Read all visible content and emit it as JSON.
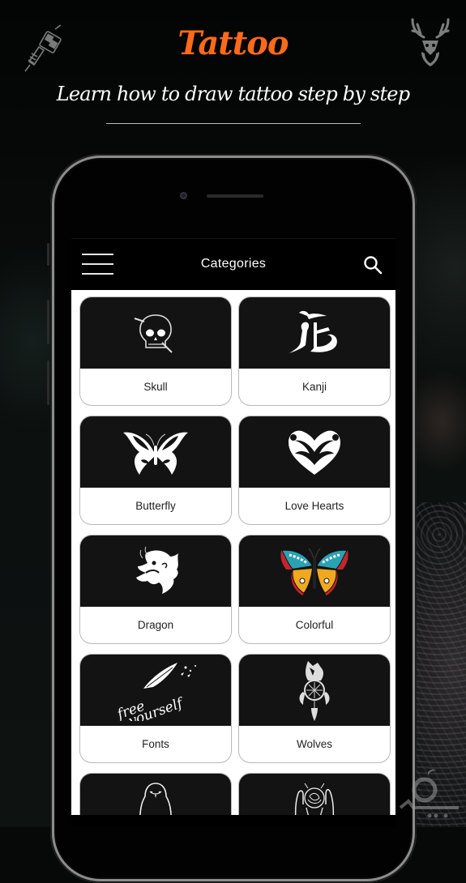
{
  "header": {
    "title": "Tattoo",
    "subtitle": "Learn how to draw tattoo step by step",
    "left_icon": "tattoo-machine-icon",
    "right_icon": "deer-head-icon"
  },
  "colors": {
    "title": "#ff6a1a",
    "app_bar": "#000000",
    "card_image_bg": "#131313",
    "card_label": "#222222"
  },
  "app": {
    "bar_title": "Categories",
    "menu_icon": "hamburger-menu-icon",
    "search_icon": "search-icon",
    "categories": [
      {
        "label": "Skull",
        "icon": "skull-icon"
      },
      {
        "label": "Kanji",
        "icon": "kanji-icon"
      },
      {
        "label": "Butterfly",
        "icon": "tribal-butterfly-icon"
      },
      {
        "label": "Love Hearts",
        "icon": "tribal-heart-icon"
      },
      {
        "label": "Dragon",
        "icon": "dragon-head-icon"
      },
      {
        "label": "Colorful",
        "icon": "colorful-butterfly-icon"
      },
      {
        "label": "Fonts",
        "icon": "free-yourself-script-icon"
      },
      {
        "label": "Wolves",
        "icon": "wolf-dreamcatcher-icon"
      },
      {
        "label": "",
        "icon": "penguin-icon"
      },
      {
        "label": "",
        "icon": "hands-rose-icon"
      }
    ]
  }
}
